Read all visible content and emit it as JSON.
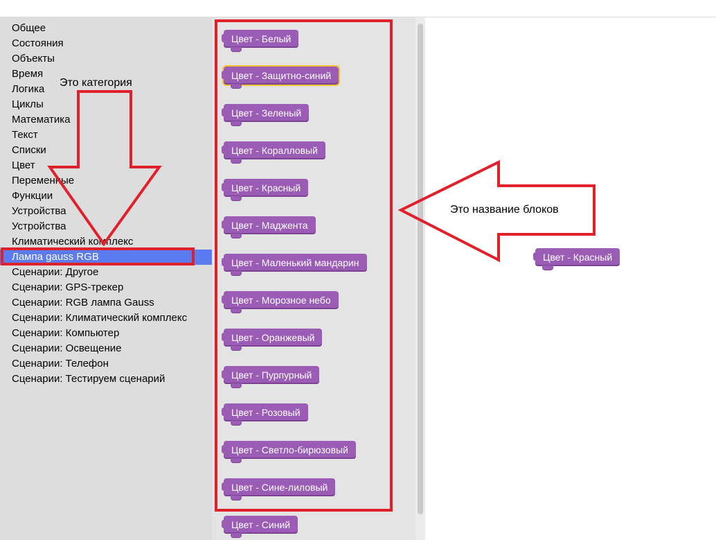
{
  "toolbox": {
    "categories": [
      "Общее",
      "Состояния",
      "Объекты",
      "Время",
      "Логика",
      "Циклы",
      "Математика",
      "Текст",
      "Списки",
      "Цвет",
      "Переменные",
      "Функции",
      "Устройства",
      "Устройства",
      "Климатический комплекс",
      "Лампа gauss RGB",
      "Сценарии: Другое",
      "Сценарии: GPS-трекер",
      "Сценарии: RGB лампа Gauss",
      "Сценарии: Климатический комплекс",
      "Сценарии: Компьютер",
      "Сценарии: Освещение",
      "Сценарии: Телефон",
      "Сценарии: Тестируем сценарий"
    ],
    "selected_category": "Лампа gauss RGB"
  },
  "flyout": {
    "blocks": [
      "Цвет - Белый",
      "Цвет - Защитно-синий",
      "Цвет - Зеленый",
      "Цвет - Коралловый",
      "Цвет - Красный",
      "Цвет - Маджента",
      "Цвет - Маленький мандарин",
      "Цвет - Морозное небо",
      "Цвет - Оранжевый",
      "Цвет - Пурпурный",
      "Цвет - Розовый",
      "Цвет - Светло-бирюзовый",
      "Цвет - Сине-лиловый",
      "Цвет - Синий"
    ],
    "selected_block": "Цвет - Защитно-синий"
  },
  "workspace": {
    "blocks": [
      "Цвет - Красный"
    ]
  },
  "annotations": {
    "category_label": "Это категория",
    "blocks_label": "Это название блоков"
  },
  "colors": {
    "block": "#9a5cb4",
    "selected_category": "#5b7bf0",
    "annotation": "#e0202a",
    "selected_outline": "#f4c430"
  }
}
